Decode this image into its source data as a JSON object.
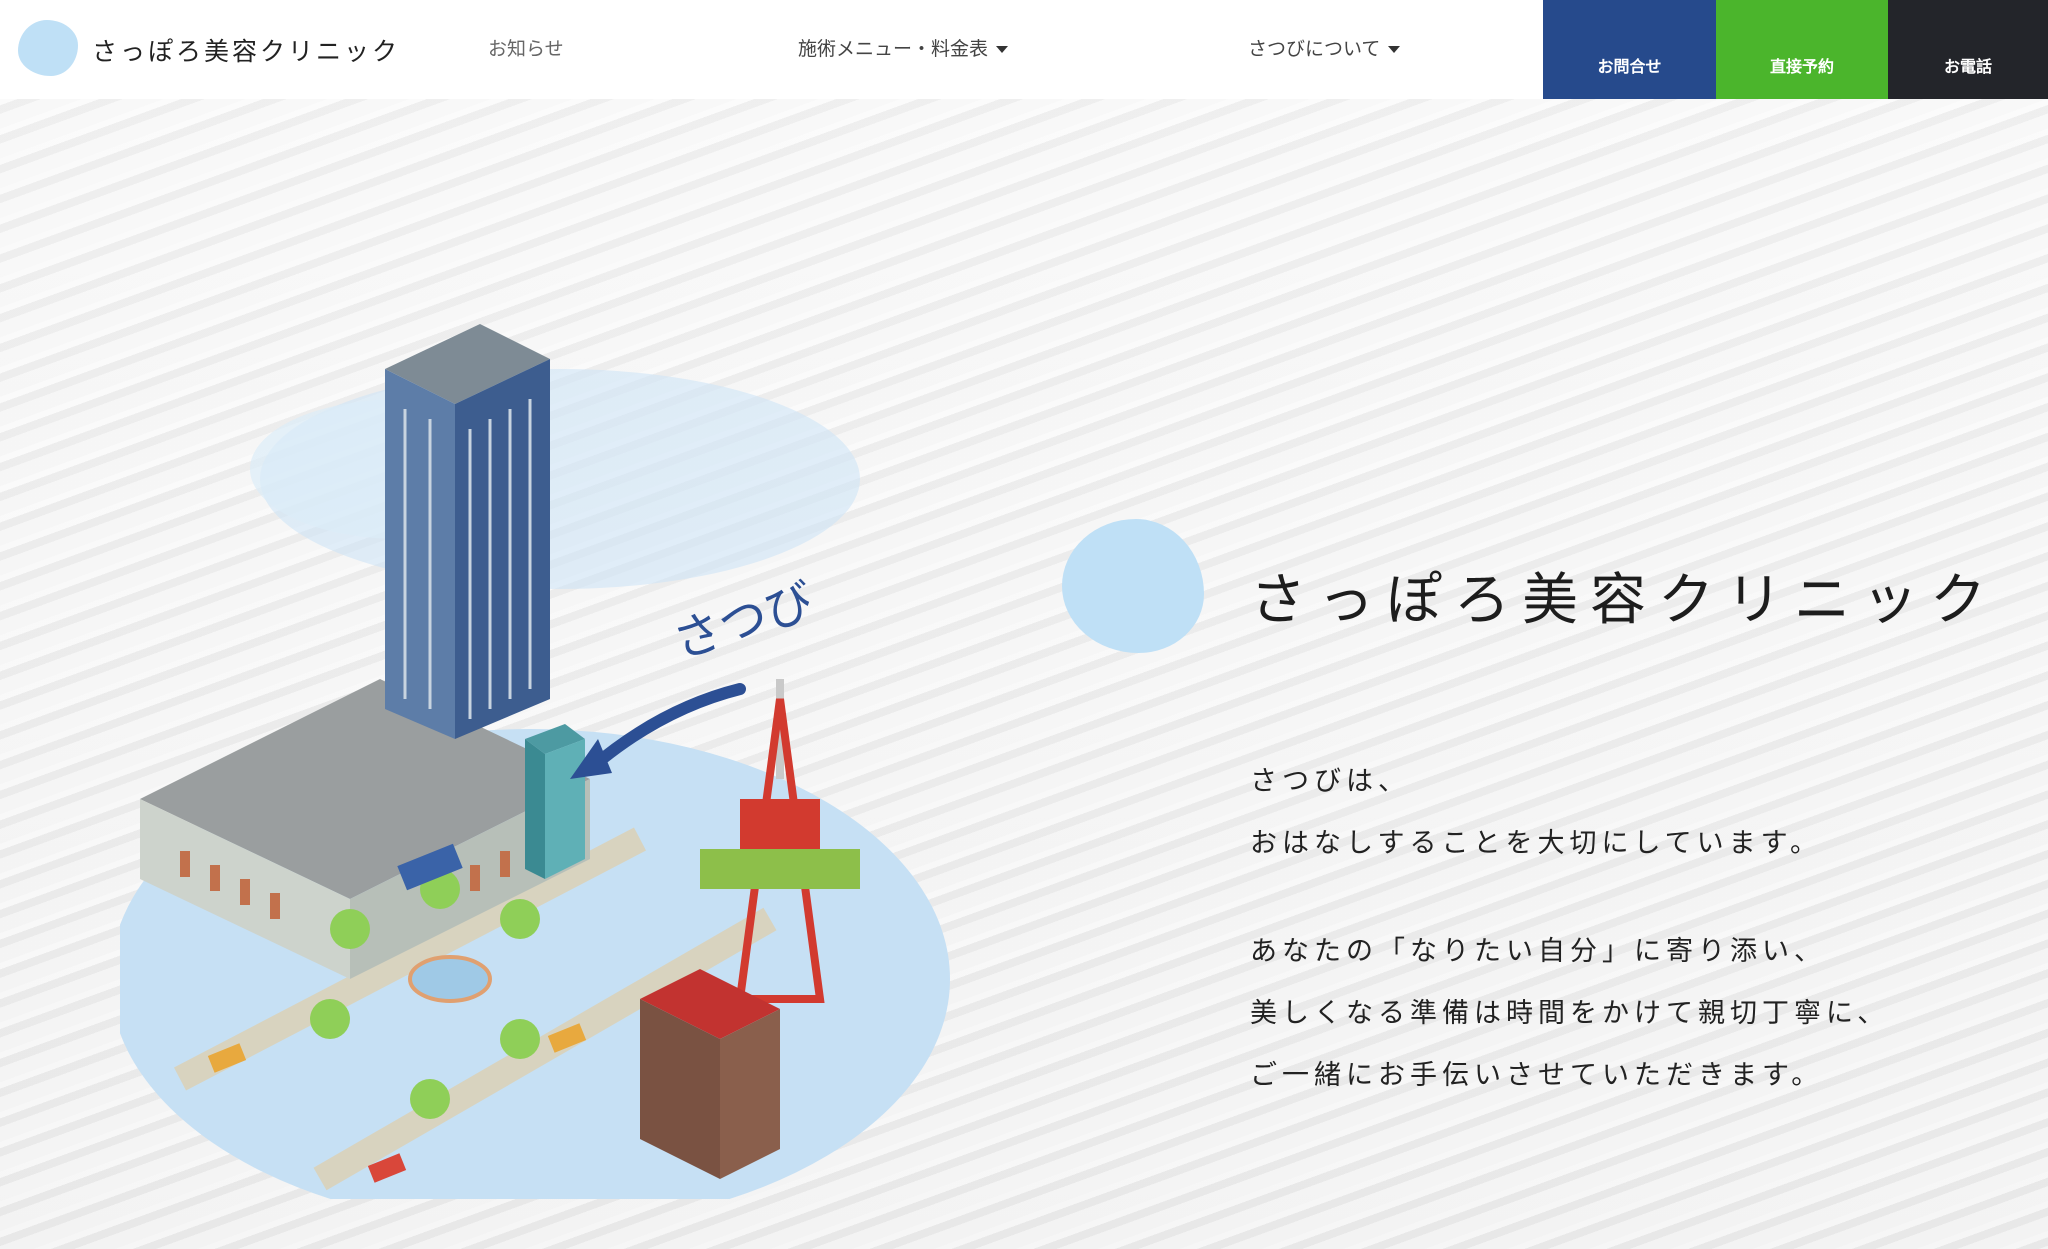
{
  "header": {
    "logo_text": "さっぽろ美容クリニック",
    "nav": {
      "news": "お知らせ",
      "menu": "施術メニュー・料金表",
      "about": "さつびについて"
    },
    "cta": {
      "contact": "お問合せ",
      "reserve": "直接予約",
      "phone": "お電話"
    }
  },
  "hero": {
    "title": "さっぽろ美容クリニック",
    "illustration_label": "さつび",
    "lines": [
      "さつびは、",
      "おはなしすることを大切にしています。",
      "あなたの「なりたい自分」に寄り添い、",
      "美しくなる準備は時間をかけて親切丁寧に、",
      "ご一緒にお手伝いさせていただきます。"
    ]
  },
  "colors": {
    "contact": "#264a8c",
    "reserve": "#4bb52c",
    "phone": "#23252a",
    "blob": "#bfe0f6"
  }
}
